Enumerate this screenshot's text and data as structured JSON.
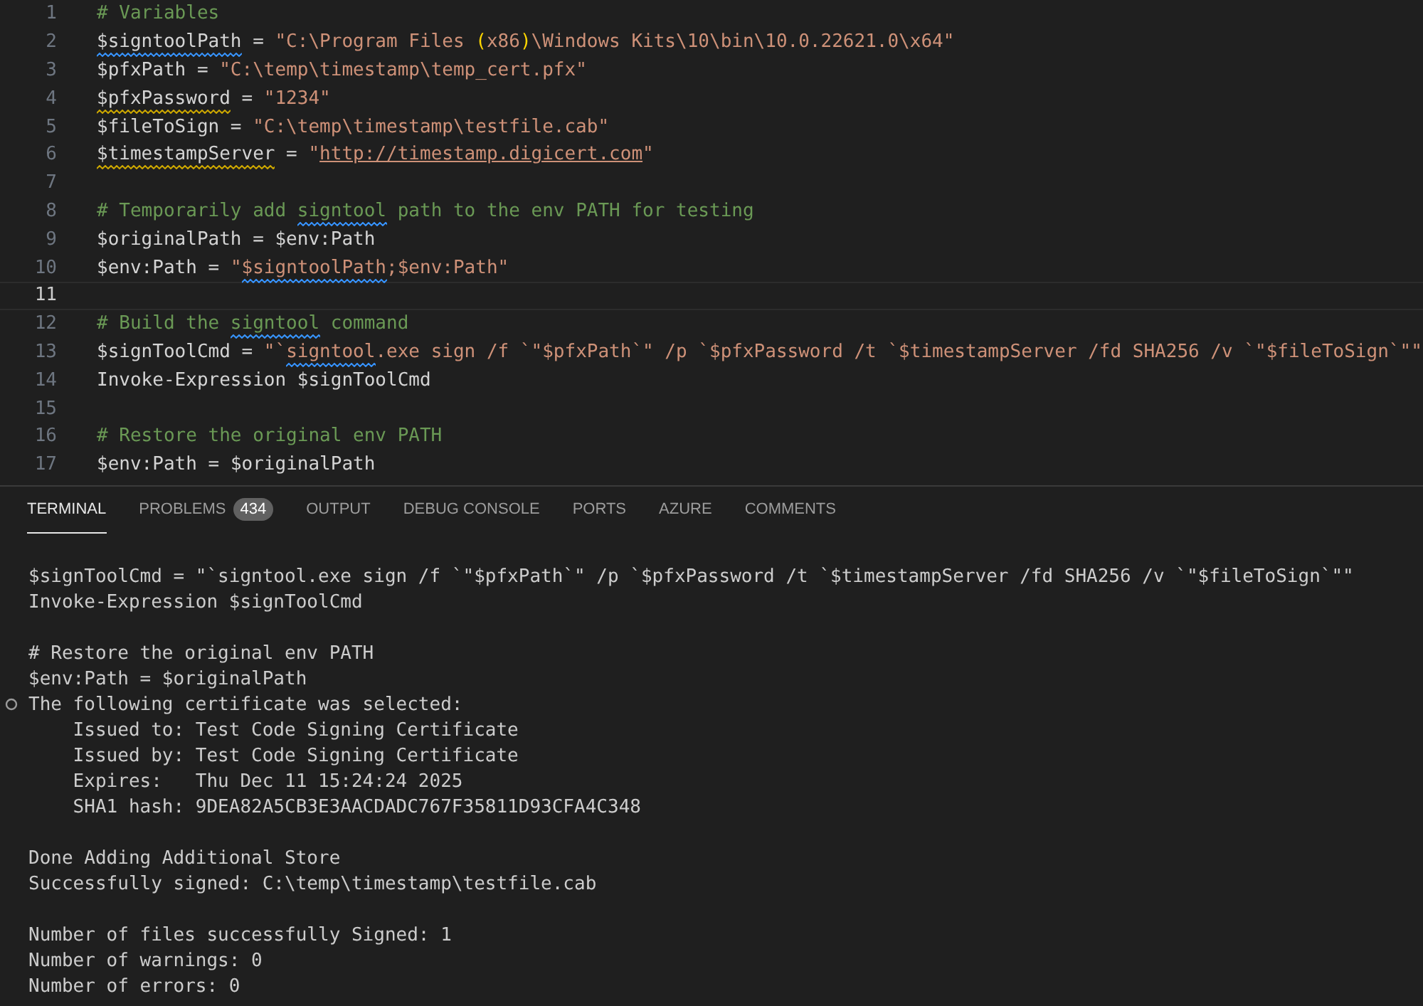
{
  "editor": {
    "lines": [
      {
        "number": "1",
        "active": false,
        "tokens": [
          {
            "text": "# Variables",
            "kind": "comment"
          }
        ]
      },
      {
        "number": "2",
        "active": false,
        "tokens": [
          {
            "text": "$signtoolPath",
            "kind": "var",
            "color": "#3794ff"
          },
          {
            "text": " = ",
            "kind": "op"
          },
          {
            "text": "\"C:\\Program Files ",
            "kind": "string"
          },
          {
            "text": "(",
            "kind": "paren"
          },
          {
            "text": "x86",
            "kind": "string"
          },
          {
            "text": ")",
            "kind": "paren"
          },
          {
            "text": "\\Windows Kits\\10\\bin\\10.0.22621.0\\x64\"",
            "kind": "string"
          }
        ]
      },
      {
        "number": "3",
        "active": false,
        "tokens": [
          {
            "text": "$pfxPath",
            "kind": "var"
          },
          {
            "text": " = ",
            "kind": "op"
          },
          {
            "text": "\"C:\\temp\\timestamp\\temp_cert.pfx\"",
            "kind": "string"
          }
        ]
      },
      {
        "number": "4",
        "active": false,
        "tokens": [
          {
            "text": "$pfxPassword",
            "kind": "var",
            "color": "#cca700"
          },
          {
            "text": " = ",
            "kind": "op"
          },
          {
            "text": "\"1234\"",
            "kind": "string"
          }
        ]
      },
      {
        "number": "5",
        "active": false,
        "tokens": [
          {
            "text": "$fileToSign",
            "kind": "var"
          },
          {
            "text": " = ",
            "kind": "op"
          },
          {
            "text": "\"C:\\temp\\timestamp\\testfile.cab\"",
            "kind": "string"
          }
        ]
      },
      {
        "number": "6",
        "active": false,
        "tokens": [
          {
            "text": "$timestampServer",
            "kind": "var",
            "color": "#cca700"
          },
          {
            "text": " = ",
            "kind": "op"
          },
          {
            "text": "\"",
            "kind": "string"
          },
          {
            "text": "http://timestamp.digicert.com",
            "kind": "link"
          },
          {
            "text": "\"",
            "kind": "string"
          }
        ]
      },
      {
        "number": "7",
        "active": false
      },
      {
        "number": "8",
        "active": false,
        "tokens": [
          {
            "text": "# Temporarily add ",
            "kind": "comment"
          },
          {
            "text": "signtool",
            "kind": "comment",
            "color": "#3794ff"
          },
          {
            "text": " path to the env PATH for testing",
            "kind": "comment"
          }
        ]
      },
      {
        "number": "9",
        "active": false,
        "tokens": [
          {
            "text": "$originalPath",
            "kind": "var"
          },
          {
            "text": " = ",
            "kind": "op"
          },
          {
            "text": "$env:Path",
            "kind": "var"
          }
        ]
      },
      {
        "number": "10",
        "active": false,
        "tokens": [
          {
            "text": "$env:Path",
            "kind": "var"
          },
          {
            "text": " = ",
            "kind": "op"
          },
          {
            "text": "\"",
            "kind": "string"
          },
          {
            "text": "$signtoolPath",
            "kind": "string",
            "color": "#3794ff"
          },
          {
            "text": ";$env:Path\"",
            "kind": "string"
          }
        ]
      },
      {
        "number": "11",
        "active": true
      },
      {
        "number": "12",
        "active": false,
        "tokens": [
          {
            "text": "# Build the ",
            "kind": "comment"
          },
          {
            "text": "signtool",
            "kind": "comment",
            "color": "#3794ff"
          },
          {
            "text": " command",
            "kind": "comment"
          }
        ]
      },
      {
        "number": "13",
        "active": false,
        "tokens": [
          {
            "text": "$signToolCmd",
            "kind": "var"
          },
          {
            "text": " = ",
            "kind": "op"
          },
          {
            "text": "\"`",
            "kind": "string"
          },
          {
            "text": "signtool",
            "kind": "string",
            "color": "#3794ff"
          },
          {
            "text": ".exe sign /f `\"$pfxPath`\" /p `$pfxPassword /t `$timestampServer /fd SHA256 /v `\"$fileToSign`\"\"",
            "kind": "string"
          }
        ]
      },
      {
        "number": "14",
        "active": false,
        "tokens": [
          {
            "text": "Invoke-Expression ",
            "kind": "op"
          },
          {
            "text": "$signToolCmd",
            "kind": "var"
          }
        ]
      },
      {
        "number": "15",
        "active": false
      },
      {
        "number": "16",
        "active": false,
        "tokens": [
          {
            "text": "# Restore the original env PATH",
            "kind": "comment"
          }
        ]
      },
      {
        "number": "17",
        "active": false,
        "tokens": [
          {
            "text": "$env:Path",
            "kind": "var"
          },
          {
            "text": " = ",
            "kind": "op"
          },
          {
            "text": "$originalPath",
            "kind": "var"
          }
        ]
      }
    ]
  },
  "panel": {
    "tabs": [
      {
        "label": "TERMINAL",
        "selected": true
      },
      {
        "label": "PROBLEMS",
        "selected": false,
        "badge": "434"
      },
      {
        "label": "OUTPUT",
        "selected": false
      },
      {
        "label": "DEBUG CONSOLE",
        "selected": false
      },
      {
        "label": "PORTS",
        "selected": false
      },
      {
        "label": "AZURE",
        "selected": false
      },
      {
        "label": "COMMENTS",
        "selected": false
      }
    ],
    "terminal": {
      "lines": [
        {
          "kind": "blank"
        },
        {
          "kind": "text",
          "text": "$signToolCmd = \"`signtool.exe sign /f `\"$pfxPath`\" /p `$pfxPassword /t `$timestampServer /fd SHA256 /v `\"$fileToSign`\"\""
        },
        {
          "kind": "text",
          "text": "Invoke-Expression $signToolCmd"
        },
        {
          "kind": "blank"
        },
        {
          "kind": "text",
          "text": "# Restore the original env PATH"
        },
        {
          "kind": "text",
          "text": "$env:Path = $originalPath"
        },
        {
          "kind": "command",
          "text": "The following certificate was selected:"
        },
        {
          "kind": "text",
          "text": "    Issued to: Test Code Signing Certificate"
        },
        {
          "kind": "text",
          "text": "    Issued by: Test Code Signing Certificate"
        },
        {
          "kind": "text",
          "text": "    Expires:   Thu Dec 11 15:24:24 2025"
        },
        {
          "kind": "text",
          "text": "    SHA1 hash: 9DEA82A5CB3E3AACDADC767F35811D93CFA4C348"
        },
        {
          "kind": "blank"
        },
        {
          "kind": "text",
          "text": "Done Adding Additional Store"
        },
        {
          "kind": "text",
          "text": "Successfully signed: C:\\temp\\timestamp\\testfile.cab"
        },
        {
          "kind": "blank"
        },
        {
          "kind": "text",
          "text": "Number of files successfully Signed: 1"
        },
        {
          "kind": "text",
          "text": "Number of warnings: 0"
        },
        {
          "kind": "text",
          "text": "Number of errors: 0"
        }
      ]
    }
  }
}
